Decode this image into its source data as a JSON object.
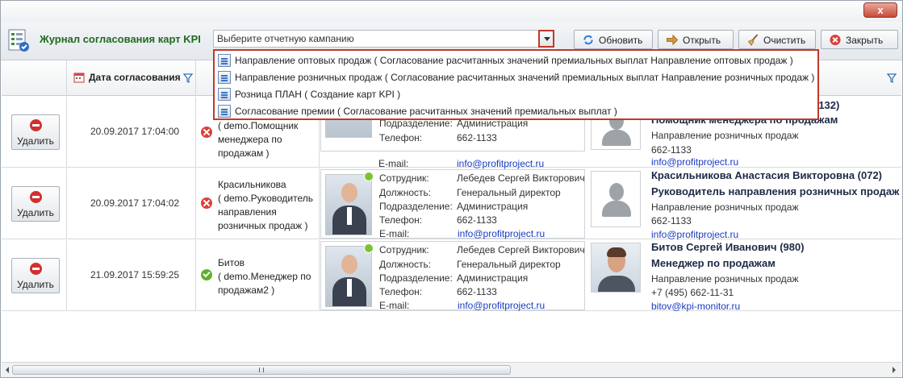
{
  "window": {
    "close_glyph": "x"
  },
  "toolbar": {
    "title": "Журнал согласования карт KPI",
    "campaign_placeholder": "Выберите отчетную кампанию",
    "refresh_label": "Обновить",
    "open_label": "Открыть",
    "clear_label": "Очистить",
    "close_label": "Закрыть"
  },
  "grid": {
    "date_header": "Дата согласования"
  },
  "dropdown": {
    "items": [
      "Направление оптовых продаж ( Согласование расчитанных значений премиальных выплат Направление оптовых продаж )",
      "Направление розничных продаж ( Согласование расчитанных значений премиальных выплат Направление розничных продаж )",
      "Розница ПЛАН ( Создание карт KPI )",
      "Согласование премии ( Согласование расчитанных значений премиальных выплат )"
    ]
  },
  "labels": {
    "delete": "Удалить",
    "employee": "Сотрудник:",
    "position": "Должность:",
    "department": "Подразделение:",
    "phone": "Телефон:",
    "email": "E-mail:"
  },
  "rows": [
    {
      "date": "20.09.2017 17:04:00",
      "status": "rejected",
      "user_lines": [
        "( demo.Помощник",
        "менеджера по",
        "продажам )"
      ],
      "approver": {
        "department": "Администрация",
        "phone": "662-1133",
        "email": "info@profitproject.ru"
      },
      "responsible": {
        "name_suffix": "(132)",
        "position": "Помощник менеджера по продажам",
        "department": "Направление розничных продаж",
        "phone": "662-1133",
        "email": "info@profitproject.ru"
      }
    },
    {
      "date": "20.09.2017 17:04:02",
      "status": "rejected",
      "user_lines": [
        "Красильникова",
        "( demo.Руководитель",
        "направления",
        "розничных продаж )"
      ],
      "approver": {
        "name": "Лебедев Сергей Викторович",
        "position": "Генеральный директор",
        "department": "Администрация",
        "phone": "662-1133",
        "email": "info@profitproject.ru"
      },
      "responsible": {
        "name": "Красильникова Анастасия Викторовна  (072)",
        "position": "Руководитель направления розничных продаж",
        "department": "Направление розничных продаж",
        "phone": "662-1133",
        "email": "info@profitproject.ru"
      }
    },
    {
      "date": "21.09.2017 15:59:25",
      "status": "approved",
      "user_lines": [
        "Битов",
        "( demo.Менеджер по",
        "продажам2 )"
      ],
      "approver": {
        "name": "Лебедев Сергей Викторович",
        "position": "Генеральный директор",
        "department": "Администрация",
        "phone": "662-1133",
        "email": "info@profitproject.ru"
      },
      "responsible": {
        "name": "Битов Сергей Иванович (980)",
        "position": "Менеджер по продажам",
        "department": "Направление розничных продаж",
        "phone": "+7 (495) 662-11-31",
        "email": "bitov@kpi-monitor.ru"
      }
    }
  ],
  "colors": {
    "accent_red": "#c0392b",
    "title_green": "#1f6a1f",
    "link_blue": "#1a3cc0"
  }
}
